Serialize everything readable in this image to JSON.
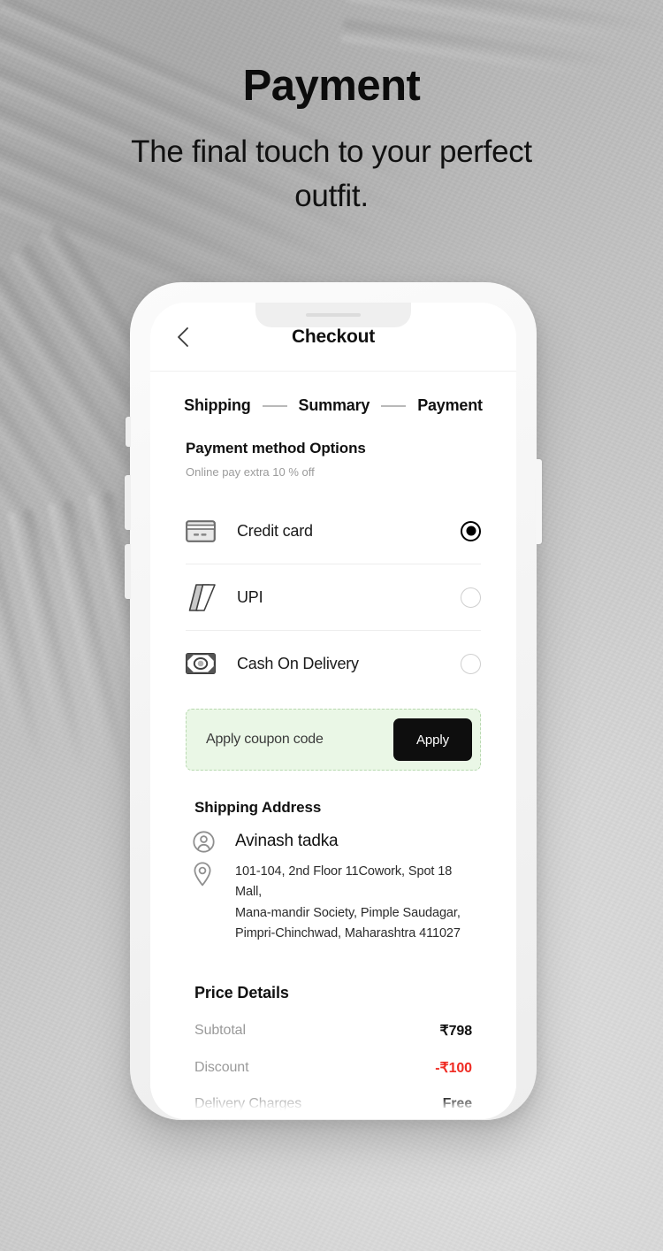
{
  "hero": {
    "title": "Payment",
    "subtitle": "The final touch to your perfect outfit."
  },
  "phone": {
    "header": {
      "back_icon": "chevron-left-icon",
      "title": "Checkout"
    },
    "steps": [
      {
        "label": "Shipping"
      },
      {
        "label": "Summary"
      },
      {
        "label": "Payment"
      }
    ],
    "payment_section": {
      "title": "Payment method Options",
      "subtitle": "Online pay extra 10 % off",
      "options": [
        {
          "label": "Credit card",
          "icon": "credit-card-icon",
          "selected": true
        },
        {
          "label": "UPI",
          "icon": "upi-icon",
          "selected": false
        },
        {
          "label": "Cash On Delivery",
          "icon": "banknote-icon",
          "selected": false
        }
      ]
    },
    "coupon": {
      "placeholder": "Apply coupon code",
      "value": "",
      "apply_label": "Apply",
      "background": "#eaf7e6",
      "border": "#b8d9b0"
    },
    "shipping_address": {
      "title": "Shipping Address",
      "name": "Avinash tadka",
      "name_icon": "user-circle-icon",
      "address_icon": "map-pin-icon",
      "address_lines": [
        "101-104, 2nd Floor 11Cowork, Spot 18 Mall,",
        "Mana-mandir Society, Pimple Saudagar,",
        "Pimpri-Chinchwad, Maharashtra 411027"
      ]
    },
    "price_details": {
      "title": "Price Details",
      "rows": [
        {
          "label": "Subtotal",
          "value": "₹798",
          "negative": false
        },
        {
          "label": "Discount",
          "value": "-₹100",
          "negative": true
        },
        {
          "label": "Delivery Charges",
          "value": "Free",
          "negative": false
        }
      ]
    }
  },
  "colors": {
    "accent_black": "#0e0e0e",
    "discount_red": "#ef2b23",
    "coupon_green": "#eaf7e6",
    "muted_gray": "#9a9a9a"
  }
}
